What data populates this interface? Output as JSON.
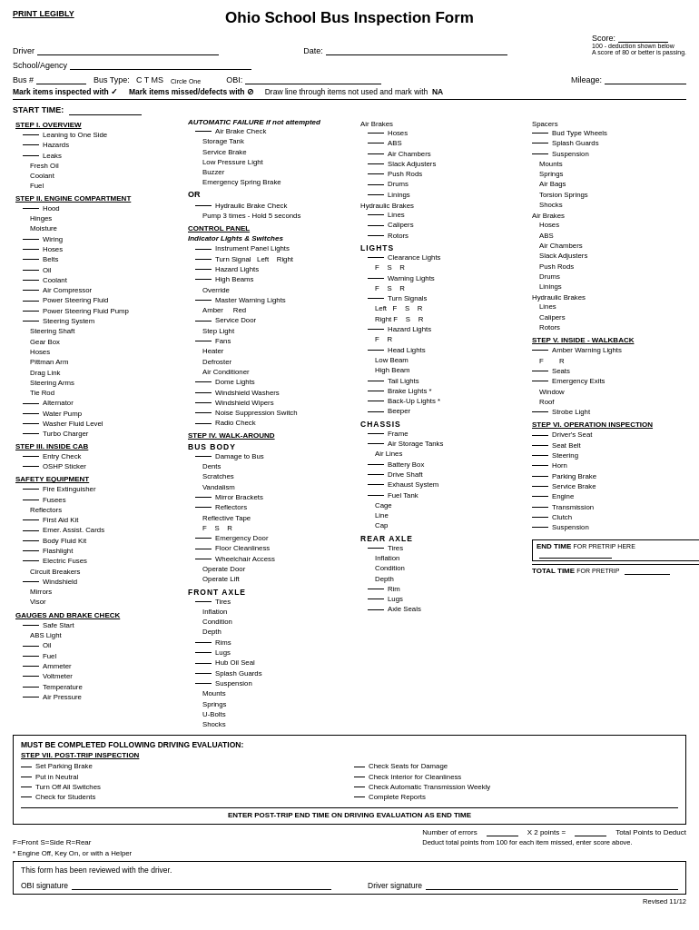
{
  "header": {
    "print_legibly": "PRINT LEGIBLY",
    "title": "Ohio School Bus Inspection Form",
    "driver_label": "Driver",
    "date_label": "Date:",
    "score_label": "Score:",
    "score_sub1": "100 - deduction shown below",
    "score_sub2": "A score of 80 or better is passing.",
    "school_label": "School/Agency",
    "bus_label": "Bus #",
    "bus_type_label": "Bus Type:",
    "bus_type_options": "C   T   MS",
    "circle_one": "Circle One",
    "obi_label": "OBI:",
    "mileage_label": "Mileage:"
  },
  "mark_instructions": {
    "part1": "Mark items inspected with ✓",
    "part2": "Mark items missed/defects with ⊘",
    "part3": "Draw line through items not used and mark with",
    "na": "NA"
  },
  "start_time_label": "START TIME:",
  "col1": {
    "step1_title": "STEP I.  OVERVIEW",
    "step1_items": [
      "Leaning to One Side",
      "Hazards",
      "Leaks",
      "Fresh Oil",
      "Coolant",
      "Fuel"
    ],
    "step2_title": "STEP II.  ENGINE COMPARTMENT",
    "step2_items": [
      "Hood",
      "Hinges",
      "Moisture",
      "Wiring",
      "Hoses",
      "Belts",
      "Oil",
      "Coolant",
      "Air Compressor",
      "Power Steering Fluid",
      "Power Steering Fluid Pump",
      "Steering System",
      "Steering Shaft",
      "Gear Box",
      "Hoses",
      "Pittman Arm",
      "Drag Link",
      "Steering Arms",
      "Tie Rod",
      "Alternator",
      "Water Pump",
      "Washer Fluid Level",
      "Turbo Charger"
    ],
    "step3_title": "STEP III.  INSIDE CAB",
    "step3_items": [
      "Entry Check",
      "OSHP Sticker"
    ],
    "safety_title": "SAFETY EQUIPMENT",
    "safety_items": [
      "Fire Extinguisher",
      "Fusees",
      "Reflectors",
      "First Aid Kit",
      "Emer. Assist. Cards",
      "Body Fluid Kit",
      "Flashlight",
      "Electric Fuses",
      "Circuit Breakers",
      "Windshield",
      "Mirrors",
      "Visor"
    ],
    "gauges_title": "GAUGES AND BRAKE CHECK",
    "gauges_items": [
      "Safe Start",
      "ABS Light",
      "Oil",
      "Fuel",
      "Ammeter",
      "Voltmeter",
      "Temperature",
      "Air Pressure"
    ]
  },
  "col2": {
    "auto_fail_title": "AUTOMATIC FAILURE if not attempted",
    "auto_fail_items": [
      "Air Brake Check",
      "Storage Tank",
      "Service Brake",
      "Low Pressure Light",
      "Buzzer",
      "Emergency Spring Brake"
    ],
    "or_text": "OR",
    "hydraulic_title": "Hydraulic Brake Check",
    "hydraulic_sub": "Pump 3 times - Hold 5 seconds",
    "control_panel_title": "CONTROL PANEL",
    "indicator_title": "Indicator Lights & Switches",
    "control_items": [
      "Instrument Panel Lights",
      "Turn Signal   Left    Right",
      "Hazard Lights",
      "High Beams",
      "Override",
      "Master Warning Lights",
      "Amber    Red",
      "Service Door",
      "Step Light",
      "Fans",
      "Heater",
      "Defroster",
      "Air Conditioner",
      "Dome Lights",
      "Windshield Washers",
      "Windshield Wipers",
      "Noise Suppression Switch",
      "Radio Check"
    ],
    "step4_title": "STEP IV.  WALK-AROUND",
    "bus_body_title": "BUS BODY",
    "bus_body_items": [
      "Damage to Bus",
      "Dents",
      "Scratches",
      "Vandalism",
      "Mirror Brackets",
      "Reflectors",
      "Reflective Tape",
      "F    S    R",
      "Emergency Door",
      "Floor Cleanliness",
      "Wheelchair Access",
      "Operate Door",
      "Operate Lift"
    ],
    "front_axle_title": "FRONT AXLE",
    "front_axle_items": [
      "Tires",
      "Inflation",
      "Condition",
      "Depth",
      "Rims",
      "Lugs",
      "Hub Oil Seal",
      "Splash Guards",
      "Suspension",
      "Mounts",
      "Springs",
      "U-Bolts",
      "Shocks"
    ]
  },
  "col3": {
    "air_brakes_header": "Air Brakes",
    "air_items": [
      "Hoses",
      "ABS",
      "Air Chambers",
      "Slack Adjusters",
      "Push Rods",
      "Drums",
      "Linings"
    ],
    "hydraulic_brakes_header": "Hydraulic Brakes",
    "hydraulic_items": [
      "Lines",
      "Calipers",
      "Rotors"
    ],
    "lights_title": "LIGHTS",
    "lights_items": [
      "Clearance Lights",
      "F    S    R",
      "Warning Lights",
      "F    S    R",
      "Turn Signals",
      "Left  F    S    R",
      "Right F    S    R",
      "Hazard Lights",
      "F    R",
      "Head Lights",
      "Low Beam",
      "High Beam",
      "Tail Lights",
      "Brake Lights *",
      "Back-Up Lights *",
      "Beeper"
    ],
    "chassis_title": "CHASSIS",
    "chassis_items": [
      "Frame",
      "Air Storage Tanks",
      "Air Lines",
      "Battery Box",
      "Drive Shaft",
      "Exhaust System",
      "Fuel Tank",
      "Cage",
      "Line",
      "Cap"
    ],
    "rear_axle_title": "REAR AXLE",
    "rear_axle_items": [
      "Tires",
      "Inflation",
      "Condition",
      "Depth",
      "Rim",
      "Lugs",
      "Axle Seals"
    ]
  },
  "col4": {
    "air_items2": [
      "Spacers",
      "Bud Type Wheels",
      "Splash Guards",
      "Suspension",
      "Mounts",
      "Springs",
      "Air Bags",
      "Torsion Springs",
      "Shocks",
      "Air Brakes",
      "Hoses",
      "ABS",
      "Air Chambers",
      "Slack Adjusters",
      "Push Rods",
      "Drums",
      "Linings",
      "Hydraulic Brakes",
      "Lines",
      "Calipers",
      "Rotors"
    ],
    "step5_title": "STEP V.  INSIDE - WALKBACK",
    "step5_items": [
      "Amber Warning Lights",
      "F         R",
      "Seats",
      "Emergency Exits",
      "Window",
      "Roof",
      "Strobe Light"
    ],
    "step6_title": "STEP VI.  OPERATION INSPECTION",
    "step6_items": [
      "Driver's Seat",
      "Seat Belt",
      "Steering",
      "Horn",
      "Parking Brake",
      "Service Brake",
      "Engine",
      "Transmission",
      "Clutch",
      "Suspension"
    ],
    "end_time_label": "END TIME",
    "end_time_sub": "FOR PRETRIP HERE",
    "total_time_label": "TOTAL TIME",
    "total_time_sub": "FOR PRETRIP"
  },
  "bottom": {
    "must_complete": "MUST BE COMPLETED FOLLOWING DRIVING EVALUATION:",
    "step7_title": "STEP VII. POST-TRIP INSPECTION",
    "step7_items": [
      "Set Parking Brake",
      "Put in Neutral",
      "Turn Off All Switches",
      "Check for Students",
      "Check Seats for Damage",
      "Check Interior for Cleanliness",
      "Check Automatic Transmission Weekly",
      "Complete Reports"
    ],
    "enter_text": "ENTER POST-TRIP END TIME ON DRIVING EVALUATION AS END TIME"
  },
  "footer": {
    "legend": "F=Front   S=Side   R=Rear",
    "note": "* Engine Off, Key On, or with a Helper",
    "error_label": "Number of errors",
    "x2_label": "X 2 points =",
    "total_label": "Total Points to Deduct",
    "deduct_note": "Deduct total points from 100 for each item missed, enter score above.",
    "reviewed_text": "This form has been reviewed with the driver.",
    "obi_sig_label": "OBI signature",
    "driver_sig_label": "Driver signature",
    "revised": "Revised 11/12"
  }
}
